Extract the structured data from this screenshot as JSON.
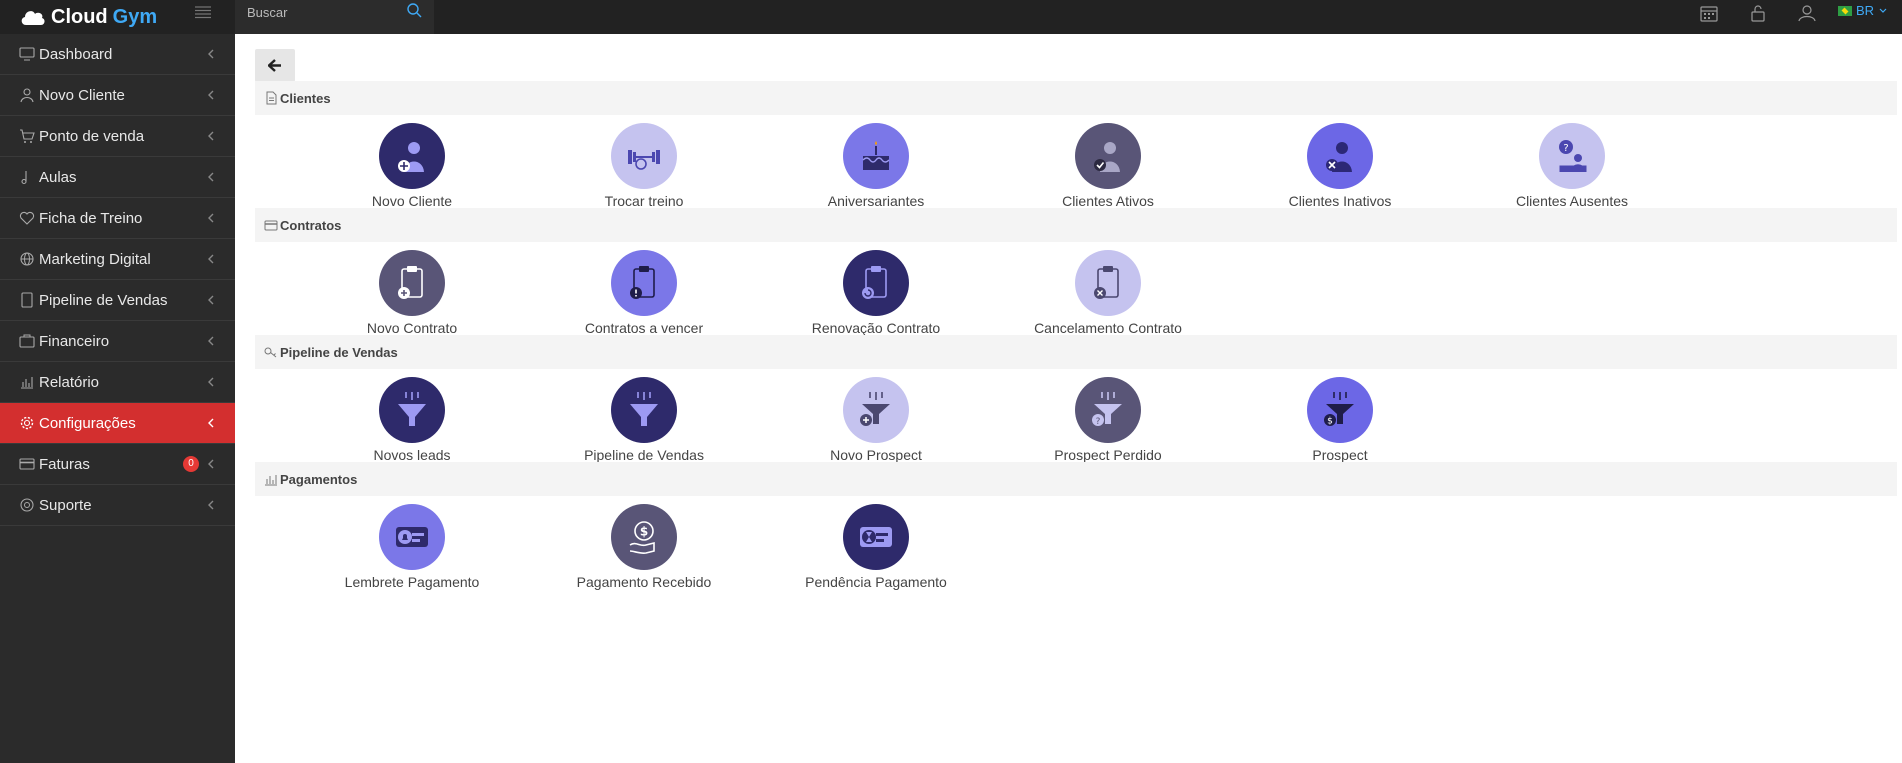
{
  "app": {
    "brand_part1": "Cloud",
    "brand_part2": "Gym",
    "brand_color": "#3fa9f5"
  },
  "search": {
    "placeholder": "Buscar"
  },
  "language": {
    "code": "BR"
  },
  "sidebar": {
    "items": [
      {
        "label": "Dashboard",
        "icon": "monitor-icon"
      },
      {
        "label": "Novo Cliente",
        "icon": "user-icon"
      },
      {
        "label": "Ponto de venda",
        "icon": "cart-icon"
      },
      {
        "label": "Aulas",
        "icon": "music-note-icon"
      },
      {
        "label": "Ficha de Treino",
        "icon": "heart-icon"
      },
      {
        "label": "Marketing Digital",
        "icon": "globe-icon"
      },
      {
        "label": "Pipeline de Vendas",
        "icon": "tablet-icon"
      },
      {
        "label": "Financeiro",
        "icon": "briefcase-icon"
      },
      {
        "label": "Relatório",
        "icon": "bar-chart-icon"
      },
      {
        "label": "Configurações",
        "icon": "gear-icon",
        "active": true
      },
      {
        "label": "Faturas",
        "icon": "credit-card-icon",
        "badge": "0"
      },
      {
        "label": "Suporte",
        "icon": "lifebuoy-icon"
      }
    ]
  },
  "sections": [
    {
      "title": "Clientes",
      "icon": "document-icon",
      "cards": [
        {
          "label": "Novo Cliente",
          "color": "#2e2a6b",
          "icon": "user-plus-icon"
        },
        {
          "label": "Trocar treino",
          "color": "#c5c3ef",
          "icon": "dumbbell-icon"
        },
        {
          "label": "Aniversariantes",
          "color": "#7b77e8",
          "icon": "cake-icon"
        },
        {
          "label": "Clientes Ativos",
          "color": "#595577",
          "icon": "user-check-icon"
        },
        {
          "label": "Clientes Inativos",
          "color": "#6c67e6",
          "icon": "user-x-icon"
        },
        {
          "label": "Clientes Ausentes",
          "color": "#c5c3ef",
          "icon": "user-question-icon"
        }
      ]
    },
    {
      "title": "Contratos",
      "icon": "credit-card-icon",
      "cards": [
        {
          "label": "Novo Contrato",
          "color": "#595577",
          "icon": "clipboard-plus-icon"
        },
        {
          "label": "Contratos a vencer",
          "color": "#7b77e8",
          "icon": "clipboard-alert-icon"
        },
        {
          "label": "Renovação Contrato",
          "color": "#2e2a6b",
          "icon": "clipboard-renew-icon"
        },
        {
          "label": "Cancelamento Contrato",
          "color": "#c5c3ef",
          "icon": "clipboard-cancel-icon"
        }
      ]
    },
    {
      "title": "Pipeline de Vendas",
      "icon": "key-icon",
      "cards": [
        {
          "label": "Novos leads",
          "color": "#2e2a6b",
          "icon": "funnel-icon"
        },
        {
          "label": "Pipeline de Vendas",
          "color": "#2e2a6b",
          "icon": "funnel-icon"
        },
        {
          "label": "Novo Prospect",
          "color": "#c5c3ef",
          "icon": "funnel-plus-icon"
        },
        {
          "label": "Prospect Perdido",
          "color": "#595577",
          "icon": "funnel-question-icon"
        },
        {
          "label": "Prospect",
          "color": "#6c67e6",
          "icon": "funnel-dollar-icon"
        }
      ]
    },
    {
      "title": "Pagamentos",
      "icon": "bar-chart-icon",
      "cards": [
        {
          "label": "Lembrete Pagamento",
          "color": "#7b77e8",
          "icon": "card-bell-icon"
        },
        {
          "label": "Pagamento Recebido",
          "color": "#595577",
          "icon": "hand-dollar-icon"
        },
        {
          "label": "Pendência Pagamento",
          "color": "#2e2a6b",
          "icon": "card-hourglass-icon"
        }
      ]
    }
  ]
}
